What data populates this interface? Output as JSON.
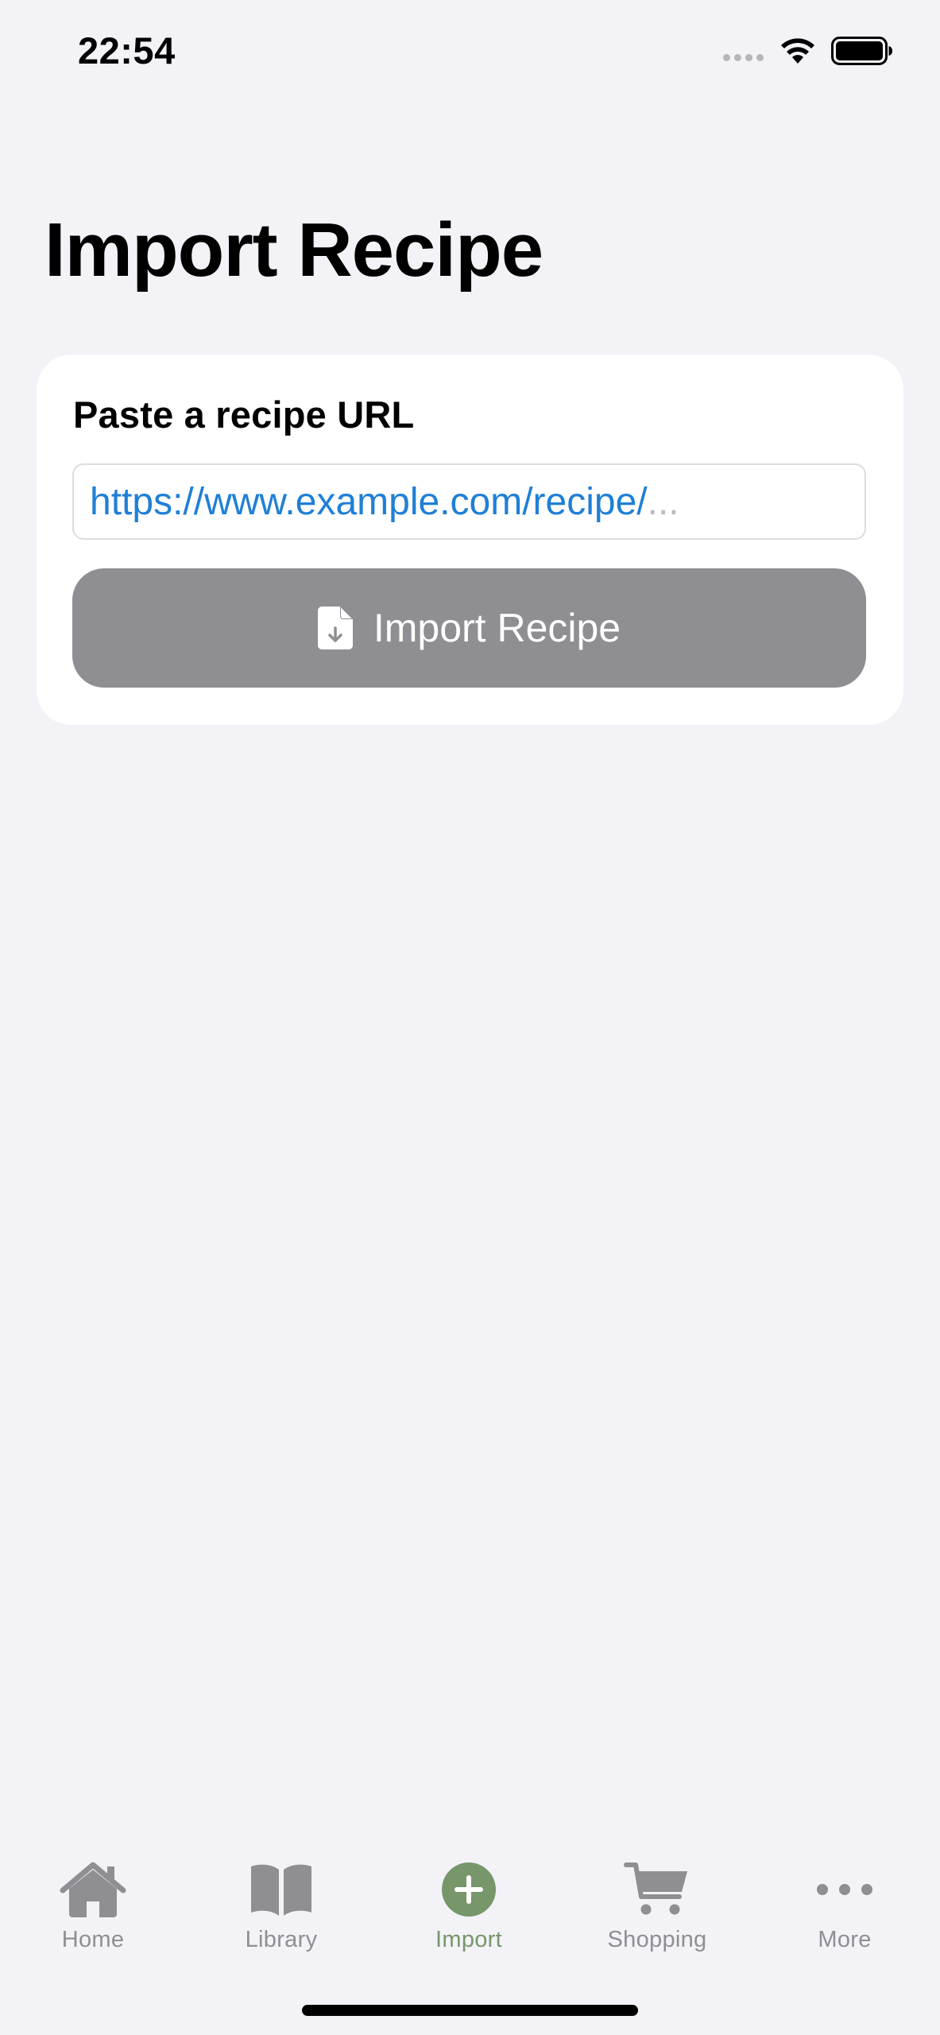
{
  "status_bar": {
    "time": "22:54"
  },
  "page": {
    "title": "Import Recipe"
  },
  "import_card": {
    "label": "Paste a recipe URL",
    "url_value": "https://www.example.com/recipe/",
    "url_overflow": "...",
    "button_label": "Import Recipe"
  },
  "tab_bar": {
    "items": [
      {
        "label": "Home",
        "icon": "house-icon"
      },
      {
        "label": "Library",
        "icon": "book-icon"
      },
      {
        "label": "Import",
        "icon": "plus-circle-icon",
        "active": true
      },
      {
        "label": "Shopping",
        "icon": "cart-icon"
      },
      {
        "label": "More",
        "icon": "ellipsis-icon"
      }
    ]
  },
  "colors": {
    "background": "#f2f2f7",
    "link_blue": "#1f7fd6",
    "button_gray": "#8e8e93",
    "active_tab_green": "#77966a",
    "inactive_tab_gray": "#8e8e93"
  }
}
